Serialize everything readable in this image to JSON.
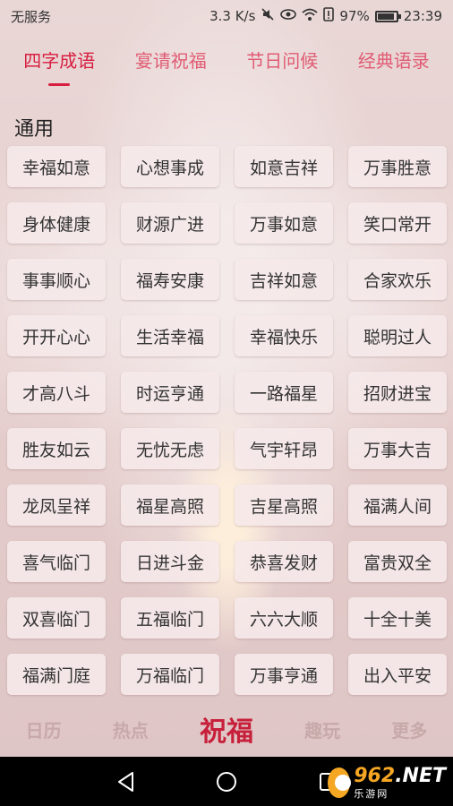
{
  "status_bar": {
    "carrier": "无服务",
    "speed": "3.3 K/s",
    "battery": "97%",
    "time": "23:39"
  },
  "tabs": [
    "四字成语",
    "宴请祝福",
    "节日问候",
    "经典语录"
  ],
  "active_tab": 0,
  "section_title": "通用",
  "phrases": [
    "幸福如意",
    "心想事成",
    "如意吉祥",
    "万事胜意",
    "身体健康",
    "财源广进",
    "万事如意",
    "笑口常开",
    "事事顺心",
    "福寿安康",
    "吉祥如意",
    "合家欢乐",
    "开开心心",
    "生活幸福",
    "幸福快乐",
    "聪明过人",
    "才高八斗",
    "时运亨通",
    "一路福星",
    "招财进宝",
    "胜友如云",
    "无忧无虑",
    "气宇轩昂",
    "万事大吉",
    "龙凤呈祥",
    "福星高照",
    "吉星高照",
    "福满人间",
    "喜气临门",
    "日进斗金",
    "恭喜发财",
    "富贵双全",
    "双喜临门",
    "五福临门",
    "六六大顺",
    "十全十美",
    "福满门庭",
    "万福临门",
    "万事亨通",
    "出入平安"
  ],
  "bottom_nav": [
    "日历",
    "热点",
    "祝福",
    "趣玩",
    "更多"
  ],
  "active_nav": 2,
  "watermark": {
    "main_prefix": "",
    "main_num": "962",
    "main_suffix": ".NET",
    "sub": "乐游网"
  },
  "colors": {
    "accent": "#d81e3f",
    "tab_inactive": "#e05c74",
    "nav_inactive": "#c7a9a9"
  }
}
